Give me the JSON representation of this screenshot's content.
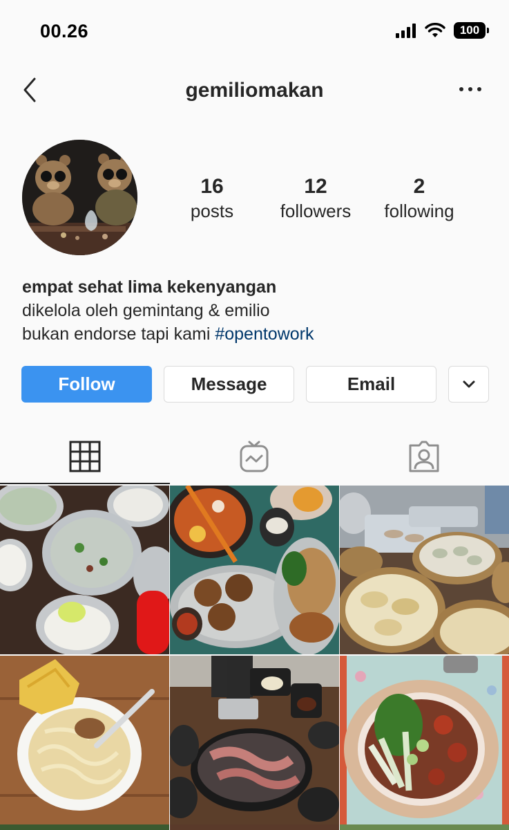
{
  "status_bar": {
    "time": "00.26",
    "battery": "100"
  },
  "nav": {
    "username": "gemiliomakan"
  },
  "profile": {
    "stats": [
      {
        "value": "16",
        "label": "posts"
      },
      {
        "value": "12",
        "label": "followers"
      },
      {
        "value": "2",
        "label": "following"
      }
    ],
    "bio": {
      "name": "empat sehat lima kekenyangan",
      "line1": "dikelola oleh gemintang & emilio",
      "line2_text": "bukan endorse tapi kami ",
      "line2_hashtag": "#opentowork"
    }
  },
  "actions": {
    "follow": "Follow",
    "message": "Message",
    "email": "Email"
  },
  "tabs": [
    {
      "icon": "grid-icon",
      "active": true
    },
    {
      "icon": "igtv-icon",
      "active": false
    },
    {
      "icon": "tagged-icon",
      "active": false
    }
  ],
  "posts": [
    "soup-rice-post",
    "noodle-platter-post",
    "dumpling-baskets-post",
    "noodle-soup-post",
    "grill-bbq-post",
    "claypot-post"
  ],
  "colors": {
    "follow_blue": "#3b93f0",
    "hashtag": "#00376b",
    "text": "#262626",
    "border": "#dbdbdb"
  }
}
